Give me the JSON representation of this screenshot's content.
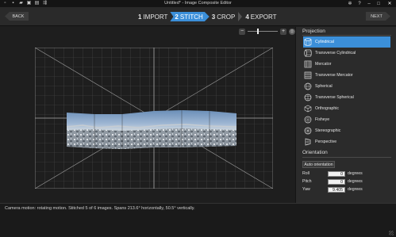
{
  "window": {
    "title": "Untitled* - Image Composite Editor",
    "quick_icons": [
      "new-icon",
      "open-icon",
      "open-folder-icon",
      "save-icon",
      "export-icon",
      "share-icon"
    ],
    "controls": [
      "settings-icon",
      "help-icon",
      "minimize-icon",
      "maximize-icon",
      "close-icon"
    ]
  },
  "nav": {
    "back_label": "BACK",
    "next_label": "NEXT",
    "steps": [
      {
        "num": "1",
        "label": "IMPORT",
        "active": false
      },
      {
        "num": "2",
        "label": "STITCH",
        "active": true
      },
      {
        "num": "3",
        "label": "CROP",
        "active": false
      },
      {
        "num": "4",
        "label": "EXPORT",
        "active": false
      }
    ]
  },
  "canvas": {
    "zoom_minus": "−",
    "zoom_plus": "+",
    "zoom_fit_icon": "fit-icon"
  },
  "projection": {
    "title": "Projection",
    "items": [
      {
        "label": "Cylindrical",
        "icon": "cylinder-icon",
        "active": true
      },
      {
        "label": "Transverse Cylindrical",
        "icon": "transverse-cylinder-icon",
        "active": false
      },
      {
        "label": "Mercator",
        "icon": "mercator-icon",
        "active": false
      },
      {
        "label": "Transverse Mercator",
        "icon": "transverse-mercator-icon",
        "active": false
      },
      {
        "label": "Spherical",
        "icon": "sphere-icon",
        "active": false
      },
      {
        "label": "Transverse Spherical",
        "icon": "transverse-sphere-icon",
        "active": false
      },
      {
        "label": "Orthographic",
        "icon": "cube-icon",
        "active": false
      },
      {
        "label": "Fisheye",
        "icon": "fisheye-icon",
        "active": false
      },
      {
        "label": "Stereographic",
        "icon": "stereographic-icon",
        "active": false
      },
      {
        "label": "Perspective",
        "icon": "perspective-icon",
        "active": false
      }
    ]
  },
  "orientation": {
    "title": "Orientation",
    "auto_label": "Auto orientation",
    "rows": [
      {
        "label": "Roll",
        "value": "0",
        "unit": "degrees"
      },
      {
        "label": "Pitch",
        "value": "0",
        "unit": "degrees"
      },
      {
        "label": "Yaw",
        "value": "9.405",
        "unit": "degrees"
      }
    ]
  },
  "status": {
    "text": "Camera motion: rotating motion. Stitched 5 of 6 images. Spans 213.6° horizontally, 50.5° vertically."
  }
}
